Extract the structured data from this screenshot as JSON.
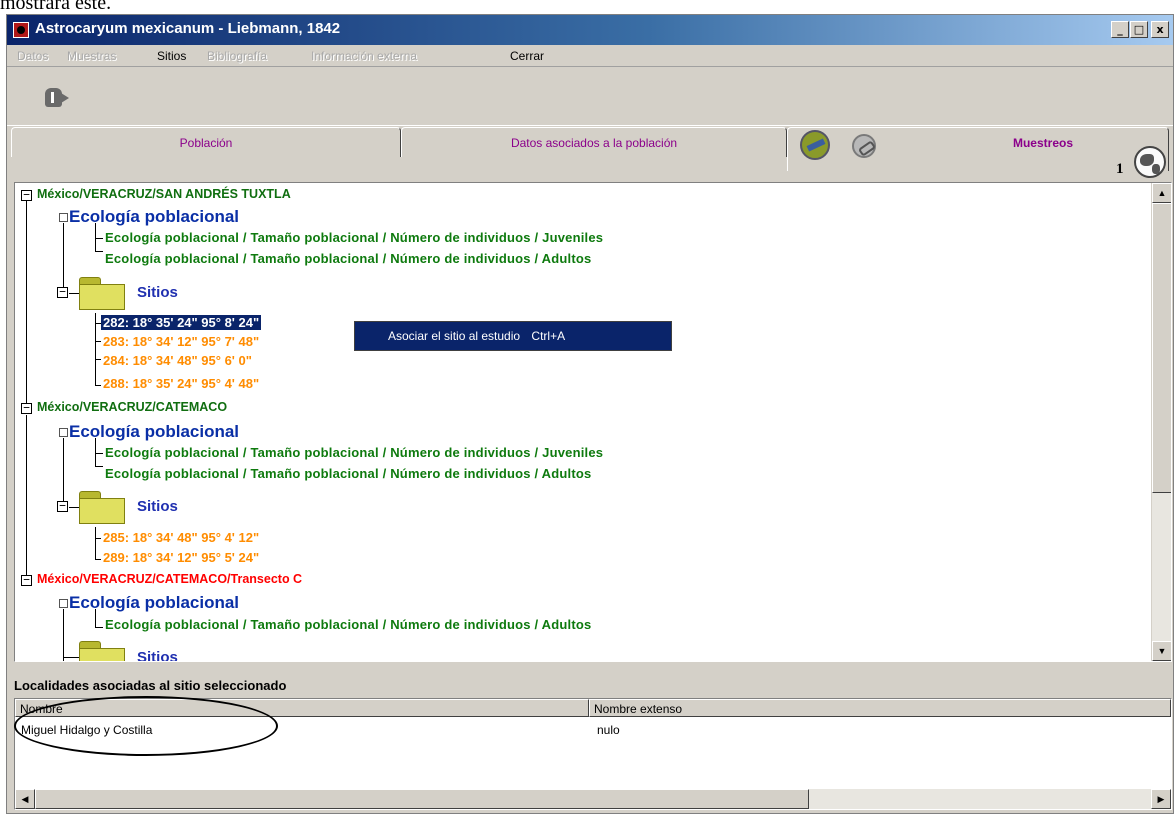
{
  "page_top_text": "mostrará este.",
  "window": {
    "title": "Astrocaryum mexicanum - Liebmann, 1842",
    "controls": {
      "minimize": "_",
      "maximize": "□",
      "close": "x"
    }
  },
  "menu": [
    {
      "label": "Datos",
      "enabled": false
    },
    {
      "label": "Muestras",
      "enabled": false
    },
    {
      "label": "Sitios",
      "enabled": true
    },
    {
      "label": "Bibliografía",
      "enabled": false
    },
    {
      "label": "Información externa",
      "enabled": false
    },
    {
      "label": "Cerrar",
      "enabled": true
    }
  ],
  "tabs": [
    {
      "label": "Población",
      "active": false
    },
    {
      "label": "Datos asociados a la población",
      "active": false
    },
    {
      "label": "Muestreos",
      "active": true
    }
  ],
  "badge_number": "1",
  "tree": {
    "groups": [
      {
        "location": "México/VERACRUZ/SAN ANDRÉS TUXTLA",
        "ecology": "Ecología poblacional",
        "paths": [
          "Ecología poblacional / Tamaño poblacional / Número de individuos / Juveniles",
          "Ecología poblacional / Tamaño poblacional / Número de individuos / Adultos"
        ],
        "sitios_label": "Sitios",
        "sites": [
          "282: 18° 35' 24\" 95° 8' 24\"",
          "283: 18° 34' 12\" 95° 7' 48\"",
          "284: 18° 34' 48\" 95° 6' 0\"",
          "288: 18° 35' 24\" 95° 4' 48\""
        ]
      },
      {
        "location": "México/VERACRUZ/CATEMACO",
        "ecology": "Ecología poblacional",
        "paths": [
          "Ecología poblacional / Tamaño poblacional / Número de individuos / Juveniles",
          "Ecología poblacional / Tamaño poblacional / Número de individuos / Adultos"
        ],
        "sitios_label": "Sitios",
        "sites": [
          "285: 18° 34' 48\" 95° 4' 12\"",
          "289: 18° 34' 12\" 95° 5' 24\""
        ]
      },
      {
        "location": "México/VERACRUZ/CATEMACO/Transecto C",
        "ecology": "Ecología poblacional",
        "paths": [
          "Ecología poblacional / Tamaño poblacional / Número de individuos / Adultos"
        ],
        "sitios_label": "Sitios"
      }
    ]
  },
  "context_menu": {
    "item_label": "Asociar el sitio al estudio",
    "shortcut": "Ctrl+A"
  },
  "localities": {
    "title": "Localidades asociadas al sitio seleccionado",
    "columns": [
      "Nombre",
      "Nombre extenso"
    ],
    "rows": [
      [
        "Miguel Hidalgo y Costilla",
        "nulo"
      ]
    ]
  },
  "colors": {
    "title_bar": "#0a246a",
    "location": "#106e10",
    "location_highlight": "#ff0000",
    "ecology": "#0a2fa6",
    "path": "#0e7a0e",
    "site": "#ff8c00",
    "tab_text": "#8b008b"
  },
  "icons": {
    "app": "app-icon",
    "exit": "exit-door-icon",
    "tab_tools": [
      "refresh-icon",
      "link-icon"
    ],
    "globe": "globe-icon",
    "folder": "folder-icon"
  }
}
